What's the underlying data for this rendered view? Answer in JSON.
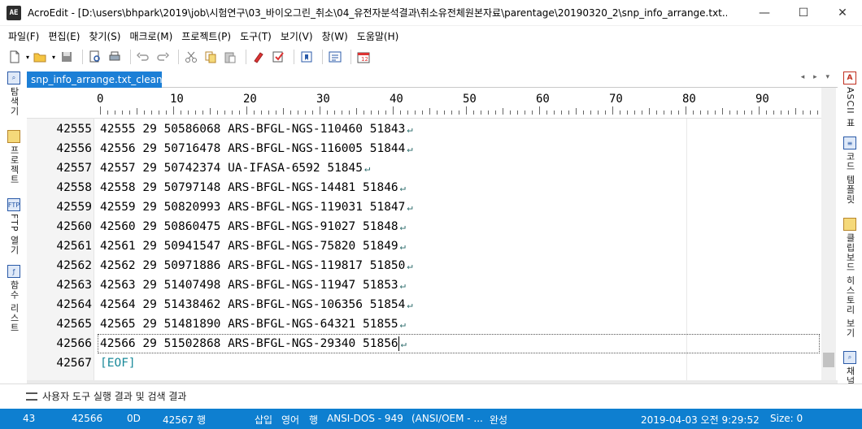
{
  "window": {
    "app_icon": "AE",
    "title": "AcroEdit - [D:\\users\\bhpark\\2019\\job\\시험연구\\03_바이오그린_취소\\04_유전자분석결과\\취소유전체원본자료\\parentage\\20190320_2\\snp_info_arrange.txt...",
    "minimize": "—",
    "maximize": "☐",
    "close": "✕"
  },
  "menu": [
    "파일(F)",
    "편집(E)",
    "찾기(S)",
    "매크로(M)",
    "프로젝트(P)",
    "도구(T)",
    "보기(V)",
    "창(W)",
    "도움말(H)"
  ],
  "toolbar_icons": [
    "new-file-icon",
    "open-folder-icon",
    "save-icon",
    "print-preview-icon",
    "print-icon",
    "undo-icon",
    "redo-icon",
    "cut-icon",
    "copy-icon",
    "paste-icon",
    "highlight-icon",
    "mark-icon",
    "bookmark-icon",
    "properties-icon",
    "calendar-icon"
  ],
  "left_panels": [
    {
      "label": "탐색기",
      "icon": "explorer-icon"
    },
    {
      "label": "프로젝트",
      "icon": "project-icon"
    },
    {
      "label": "FTP 열기",
      "icon": "ftp-icon",
      "icon_text": "FTP"
    },
    {
      "label": "함수 리스트",
      "icon": "function-list-icon"
    }
  ],
  "right_panels": [
    {
      "label": "ASCII 표",
      "icon": "ascii-table-icon",
      "icon_text": "A"
    },
    {
      "label": "코드 템플릿",
      "icon": "code-template-icon"
    },
    {
      "label": "클립보드 히스토리 보기",
      "icon": "clipboard-history-icon"
    },
    {
      "label": "채널",
      "icon": "channel-icon"
    }
  ],
  "tab": {
    "label": "snp_info_arrange.txt_clean",
    "close": "✕",
    "nav": "◂ ▸ ▾"
  },
  "ruler": {
    "labels": [
      "0",
      "10",
      "20",
      "30",
      "40",
      "50",
      "60",
      "70",
      "80",
      "90"
    ]
  },
  "editor": {
    "eol_marker": "↵",
    "lines": [
      {
        "num": "42555",
        "text": "42555 29 50586068 ARS-BFGL-NGS-110460 51843"
      },
      {
        "num": "42556",
        "text": "42556 29 50716478 ARS-BFGL-NGS-116005 51844"
      },
      {
        "num": "42557",
        "text": "42557 29 50742374 UA-IFASA-6592 51845"
      },
      {
        "num": "42558",
        "text": "42558 29 50797148 ARS-BFGL-NGS-14481 51846"
      },
      {
        "num": "42559",
        "text": "42559 29 50820993 ARS-BFGL-NGS-119031 51847"
      },
      {
        "num": "42560",
        "text": "42560 29 50860475 ARS-BFGL-NGS-91027 51848"
      },
      {
        "num": "42561",
        "text": "42561 29 50941547 ARS-BFGL-NGS-75820 51849"
      },
      {
        "num": "42562",
        "text": "42562 29 50971886 ARS-BFGL-NGS-119817 51850"
      },
      {
        "num": "42563",
        "text": "42563 29 51407498 ARS-BFGL-NGS-11947 51853"
      },
      {
        "num": "42564",
        "text": "42564 29 51438462 ARS-BFGL-NGS-106356 51854"
      },
      {
        "num": "42565",
        "text": "42565 29 51481890 ARS-BFGL-NGS-64321 51855"
      },
      {
        "num": "42566",
        "text": "42566 29 51502868 ARS-BFGL-NGS-29340 51856"
      }
    ],
    "eof_line": {
      "num": "42567",
      "text": "[EOF]"
    }
  },
  "output_panel": {
    "label": "사용자 도구 실행 결과 및 검색 결과"
  },
  "status": {
    "col": "43",
    "line": "42566",
    "char_hex": "0D",
    "total_lines": "42567 행",
    "insert_mode": "삽입",
    "lang": "영어",
    "line_mode": "행",
    "encoding": "ANSI-DOS - 949",
    "encoding_detail": "(ANSI/OEM - ...",
    "state": "완성",
    "datetime": "2019-04-03 오전 9:29:52",
    "size": "Size: 0"
  },
  "colors": {
    "accent": "#1c7fd6",
    "statusbar": "#0e7fd0",
    "eof": "#1a8a9a"
  }
}
